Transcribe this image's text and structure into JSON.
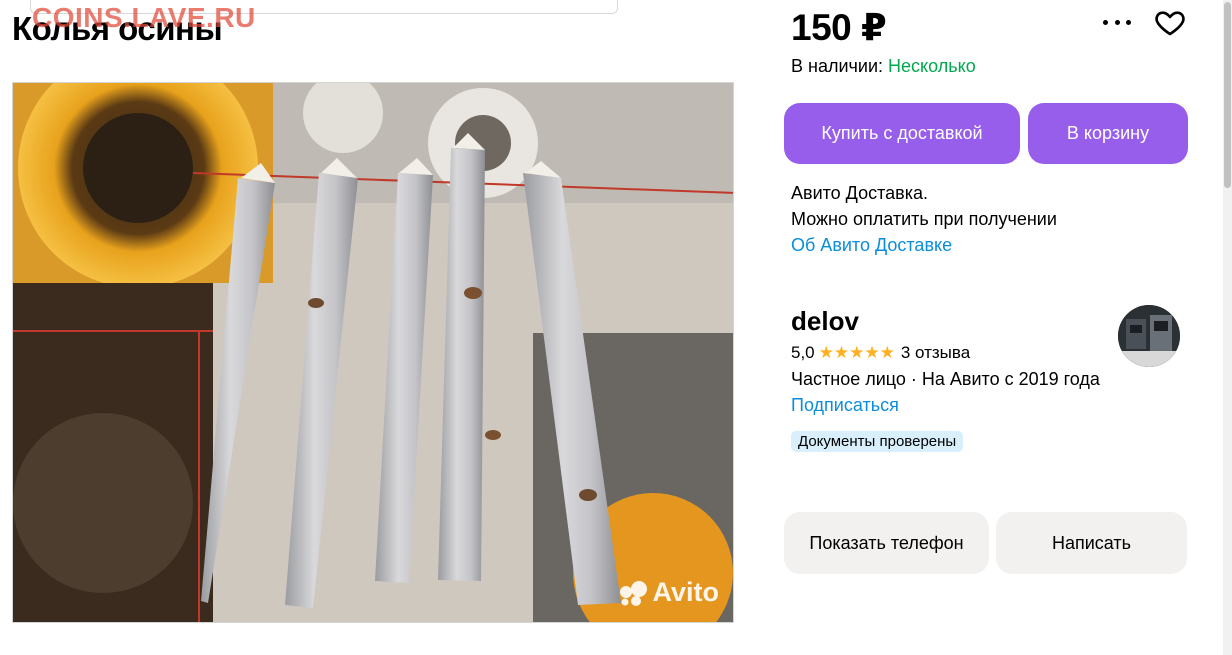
{
  "watermark": "COINS.LAVE.RU",
  "listing": {
    "title": "Колья осины",
    "price": "150 ₽",
    "stock_label": "В наличии:",
    "stock_value": "Несколько",
    "photo_watermark": "Avito"
  },
  "actions": {
    "buy_with_delivery": "Купить с доставкой",
    "add_to_cart": "В корзину",
    "show_phone": "Показать телефон",
    "write": "Написать"
  },
  "delivery": {
    "line1": "Авито Доставка.",
    "line2": "Можно оплатить при получении",
    "link": "Об Авито Доставке"
  },
  "seller": {
    "name": "delov",
    "rating": "5,0",
    "stars": "★★★★★",
    "reviews": "3 отзыва",
    "info": "Частное лицо · На Авито с 2019 года",
    "subscribe": "Подписаться",
    "badge": "Документы проверены"
  },
  "icons": [
    "more-icon",
    "heart-icon",
    "avito-logo-icon",
    "avatar"
  ],
  "colors": {
    "accent": "#965eeb",
    "stock_green": "#02a84e",
    "link_blue": "#0a8ddc",
    "star": "#ffb021",
    "badge_bg": "#d9f0fc",
    "button_grey": "#f2f1f0"
  }
}
